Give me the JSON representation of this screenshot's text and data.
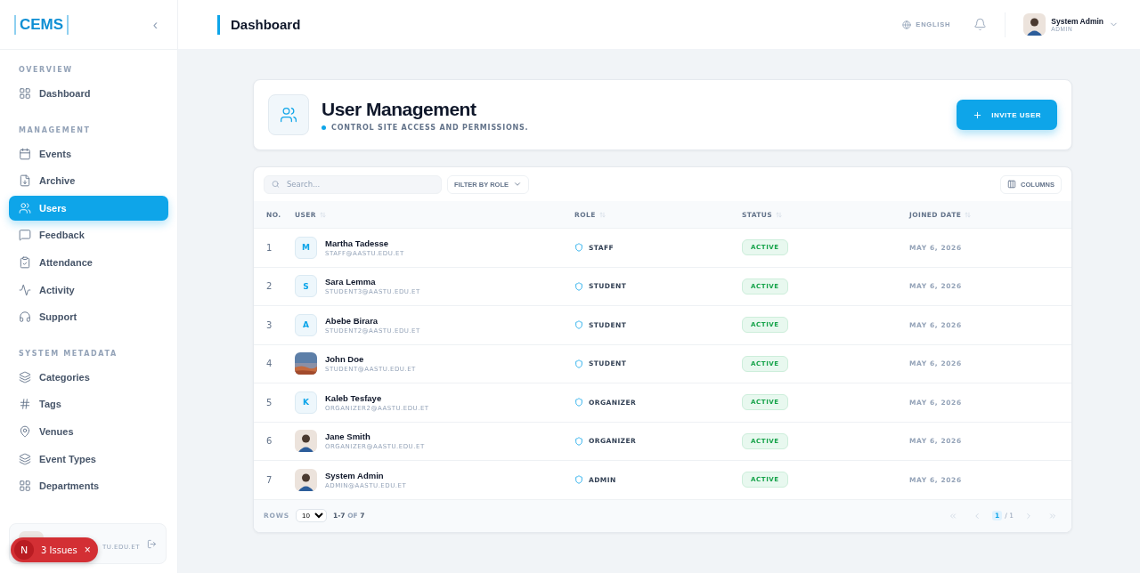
{
  "sidebar": {
    "logo": "CEMS",
    "collapse": "‹",
    "sections": [
      {
        "title": "OVERVIEW",
        "items": [
          {
            "label": "Dashboard",
            "selected": false
          }
        ]
      },
      {
        "title": "MANAGEMENT",
        "items": [
          {
            "label": "Events",
            "selected": false
          },
          {
            "label": "Archive",
            "selected": false
          },
          {
            "label": "Users",
            "selected": true
          },
          {
            "label": "Feedback",
            "selected": false
          },
          {
            "label": "Attendance",
            "selected": false
          },
          {
            "label": "Activity",
            "selected": false
          },
          {
            "label": "Support",
            "selected": false
          }
        ]
      },
      {
        "title": "SYSTEM METADATA",
        "items": [
          {
            "label": "Categories",
            "selected": false
          },
          {
            "label": "Tags",
            "selected": false
          },
          {
            "label": "Venues",
            "selected": false
          },
          {
            "label": "Event Types",
            "selected": false
          },
          {
            "label": "Departments",
            "selected": false
          }
        ]
      }
    ],
    "user_card": {
      "email": "TU.EDU.ET"
    }
  },
  "dev_badge": {
    "letter": "N",
    "label": "3 Issues",
    "close": "×"
  },
  "header": {
    "title": "Dashboard",
    "language": "ENGLISH",
    "user": {
      "name": "System Admin",
      "role": "ADMIN"
    }
  },
  "page": {
    "title": "User Management",
    "subtitle": "CONTROL SITE ACCESS AND PERMISSIONS.",
    "action": "INVITE USER"
  },
  "table": {
    "search": {
      "placeholder": "Search..."
    },
    "filter": "FILTER BY ROLE",
    "columns_button": "COLUMNS",
    "columns": [
      {
        "label": "NO.",
        "sortable": false
      },
      {
        "label": "USER",
        "sortable": true
      },
      {
        "label": "ROLE",
        "sortable": true
      },
      {
        "label": "STATUS",
        "sortable": true
      },
      {
        "label": "JOINED DATE",
        "sortable": true
      }
    ],
    "rows": [
      {
        "no": "1",
        "avatar": {
          "kind": "initial",
          "text": "M"
        },
        "name": "Martha Tadesse",
        "email": "STAFF@AASTU.EDU.ET",
        "role": "STAFF",
        "status": "ACTIVE",
        "joined": "MAY 6, 2026"
      },
      {
        "no": "2",
        "avatar": {
          "kind": "initial",
          "text": "S"
        },
        "name": "Sara Lemma",
        "email": "STUDENT3@AASTU.EDU.ET",
        "role": "STUDENT",
        "status": "ACTIVE",
        "joined": "MAY 6, 2026"
      },
      {
        "no": "3",
        "avatar": {
          "kind": "initial",
          "text": "A"
        },
        "name": "Abebe Birara",
        "email": "STUDENT2@AASTU.EDU.ET",
        "role": "STUDENT",
        "status": "ACTIVE",
        "joined": "MAY 6, 2026"
      },
      {
        "no": "4",
        "name": "John Doe",
        "email": "STUDENT@AASTU.EDU.ET",
        "role": "STUDENT",
        "status": "ACTIVE",
        "joined": "MAY 6, 2026"
      },
      {
        "no": "5",
        "avatar": {
          "kind": "initial",
          "text": "K"
        },
        "name": "Kaleb Tesfaye",
        "email": "ORGANIZER2@AASTU.EDU.ET",
        "role": "ORGANIZER",
        "status": "ACTIVE",
        "joined": "MAY 6, 2026"
      },
      {
        "no": "6",
        "avatar": {
          "kind": "person"
        },
        "name": "Jane Smith",
        "email": "ORGANIZER@AASTU.EDU.ET",
        "role": "ORGANIZER",
        "status": "ACTIVE",
        "joined": "MAY 6, 2026"
      },
      {
        "no": "7",
        "avatar": {
          "kind": "person"
        },
        "name": "System Admin",
        "email": "ADMIN@AASTU.EDU.ET",
        "role": "ADMIN",
        "status": "ACTIVE",
        "joined": "MAY 6, 2026"
      }
    ],
    "footer": {
      "rows_label": "ROWS",
      "rows_value": "10",
      "range": "1-7",
      "of": "OF",
      "total": "7",
      "page": "1",
      "pages": "/ 1"
    }
  }
}
